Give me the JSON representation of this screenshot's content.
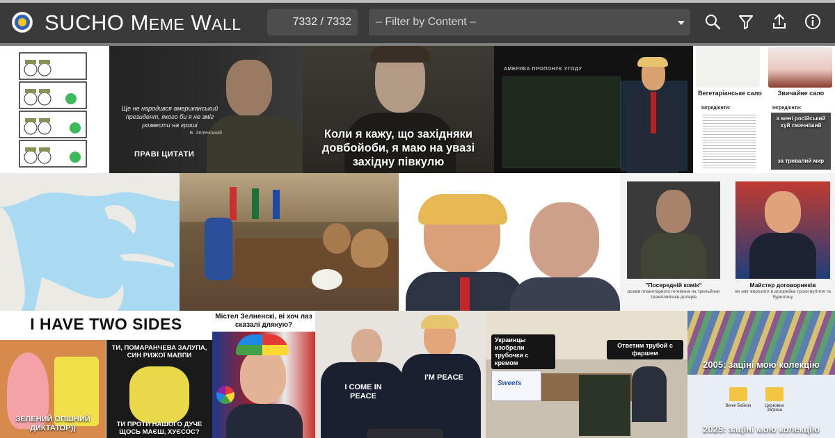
{
  "header": {
    "title_big1": "SUCHO M",
    "title_small1": "EME",
    "title_big2": " W",
    "title_small2": "ALL",
    "counter": "7332 / 7332",
    "filter_label": "– Filter by Content –"
  },
  "toolbar": {
    "search_icon": "search-icon",
    "filter_icon": "filter-icon",
    "share_icon": "share-icon",
    "info_icon": "info-icon"
  },
  "memes": {
    "zelensky_quote": "Ще не народився американський президент, якого би я не зміг розвести на гроші",
    "zelensky_author": "В. Зеленський",
    "zelensky_footer": "ПРАВІ ЦИТАТИ",
    "peaky_caption": "Коли я кажу, що західняки довбойоби, я маю на увазі західну півкулю",
    "game_header": "АМЕРИКА ПРОПОНУЄ УГОДУ",
    "salo_veg_title": "Вегетаріанське сало",
    "salo_veg_sub": "Інгредієнти:",
    "salo_reg_title": "Звичайне сало",
    "salo_reg_sub": "Інгредієнти:",
    "salo_caption1": "а мені російський хуй смачніший",
    "salo_caption2": "за тривалий мир",
    "portrait_left_caption": "\"Посередній комік\"",
    "portrait_left_sub": "розвів планетарного гегемона на трильйони трампляйонів доларів",
    "portrait_right_caption": "Майстер договорняків",
    "portrait_right_sub": "не зміг вирозити в агрорейка трохи вугілля та бурштину",
    "two_sides_title": "I HAVE TWO SIDES",
    "two_sides_left": "ЗЕЛЕНИЙ ОПШНИЙ ДИКТАТОР))",
    "two_sides_right_top": "ТИ, ПОМАРАНЧЕВА ЗАЛУПА, СИН РИЖОЇ МАВПИ",
    "two_sides_right_bottom": "ТИ ПРОТИ НАШОГО ДУЧЕ ЩОСЬ МАЄШ, ХУЄСОС?",
    "vance_caption": "Містел Зелненскі, ві хоч лаз сказалі длякую?",
    "putin_shirt": "I COME IN PEACE",
    "trump_shirt": "I'M PEACE",
    "tube_left": "Украинцы изобрели трубочки с кремом",
    "tube_right": "Ответим трубой с фаршем",
    "tube_product": "Sweets",
    "cards_top": "2005: зацінi мою колекцію",
    "cards_bottom": "2025: зацінi мою колекцію",
    "cards_folder1": "Венні Бейкон",
    "cards_folder2": "Церковна Загрозa"
  },
  "colors": {
    "header_bg": "#3a3a3a",
    "field_bg": "#4d4d4d",
    "accent_logo": "#2f62b8",
    "logo_sun": "#f3c622"
  }
}
